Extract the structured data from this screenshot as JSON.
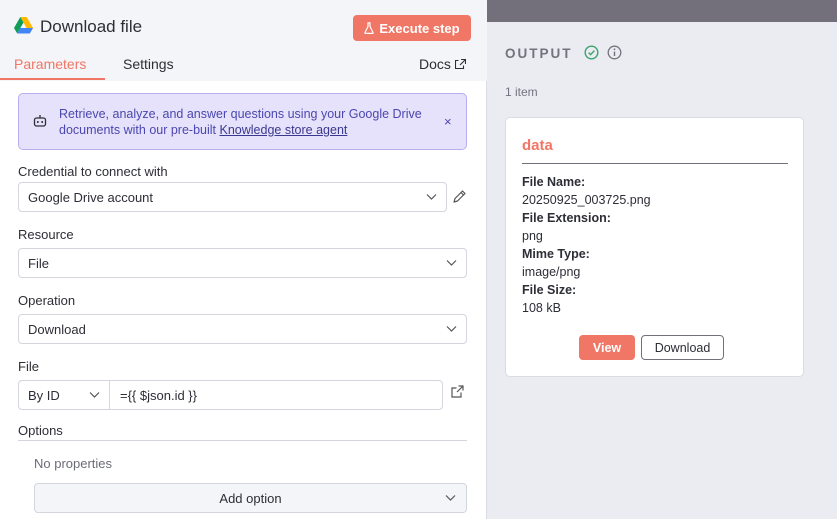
{
  "header": {
    "title": "Download file",
    "execute_label": "Execute step"
  },
  "tabs": {
    "parameters": "Parameters",
    "settings": "Settings",
    "docs": "Docs"
  },
  "banner": {
    "text": "Retrieve, analyze, and answer questions using your Google Drive documents with our pre-built ",
    "link": "Knowledge store agent",
    "close": "×"
  },
  "form": {
    "credential_label": "Credential to connect with",
    "credential_value": "Google Drive account",
    "resource_label": "Resource",
    "resource_value": "File",
    "operation_label": "Operation",
    "operation_value": "Download",
    "file_label": "File",
    "file_mode": "By ID",
    "file_expression": "={{ $json.id }}",
    "options_label": "Options",
    "no_properties": "No properties",
    "add_option": "Add option"
  },
  "output": {
    "label": "OUTPUT",
    "item_count": "1 item",
    "card": {
      "title": "data",
      "file_name_key": "File Name:",
      "file_name": "20250925_003725.png",
      "file_ext_key": "File Extension:",
      "file_ext": "png",
      "mime_key": "Mime Type:",
      "mime": "image/png",
      "size_key": "File Size:",
      "size": "108 kB",
      "view_label": "View",
      "download_label": "Download"
    }
  },
  "colors": {
    "accent": "#f07665",
    "banner_bg": "#e7e2fb",
    "banner_text": "#4a47b0",
    "success": "#3ea26a"
  }
}
